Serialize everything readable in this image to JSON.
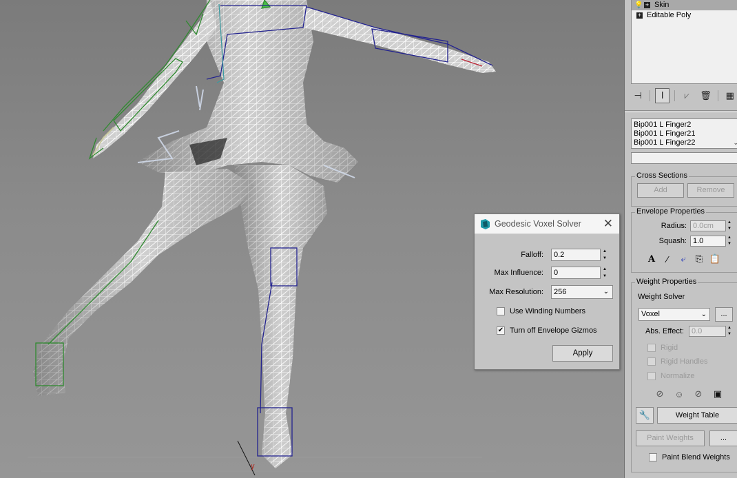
{
  "viewport": {
    "axis_labels": {
      "y": "y"
    }
  },
  "modifier_stack": {
    "items": [
      {
        "label": "Skin",
        "selected": true
      },
      {
        "label": "Editable Poly",
        "selected": false
      }
    ],
    "tools": [
      "pin-stack-icon",
      "show-end-result-icon",
      "make-unique-icon",
      "remove-modifier-icon",
      "configure-sets-icon"
    ]
  },
  "skin": {
    "bones": [
      "Bip001 L Finger2",
      "Bip001 L Finger21",
      "Bip001 L Finger22"
    ],
    "cross_sections": {
      "title": "Cross Sections",
      "add": "Add",
      "remove": "Remove"
    },
    "envelope": {
      "title": "Envelope Properties",
      "radius_label": "Radius:",
      "radius_value": "0.0cm",
      "squash_label": "Squash:",
      "squash_value": "1.0"
    },
    "weight": {
      "title": "Weight Properties",
      "solver_label": "Weight Solver",
      "solver_value": "Voxel",
      "solver_more": "...",
      "abs_effect_label": "Abs. Effect:",
      "abs_effect_value": "0.0",
      "rigid": "Rigid",
      "rigid_handles": "Rigid Handles",
      "normalize": "Normalize",
      "weight_table": "Weight Table",
      "paint_weights": "Paint Weights",
      "paint_more": "...",
      "paint_blend": "Paint Blend Weights"
    }
  },
  "dialog": {
    "title": "Geodesic Voxel Solver",
    "falloff_label": "Falloff:",
    "falloff_value": "0.2",
    "max_influence_label": "Max Influence:",
    "max_influence_value": "0",
    "max_resolution_label": "Max Resolution:",
    "max_resolution_value": "256",
    "winding_label": "Use Winding Numbers",
    "winding_checked": false,
    "envelope_gizmos_label": "Turn off Envelope Gizmos",
    "envelope_gizmos_checked": true,
    "apply": "Apply"
  }
}
